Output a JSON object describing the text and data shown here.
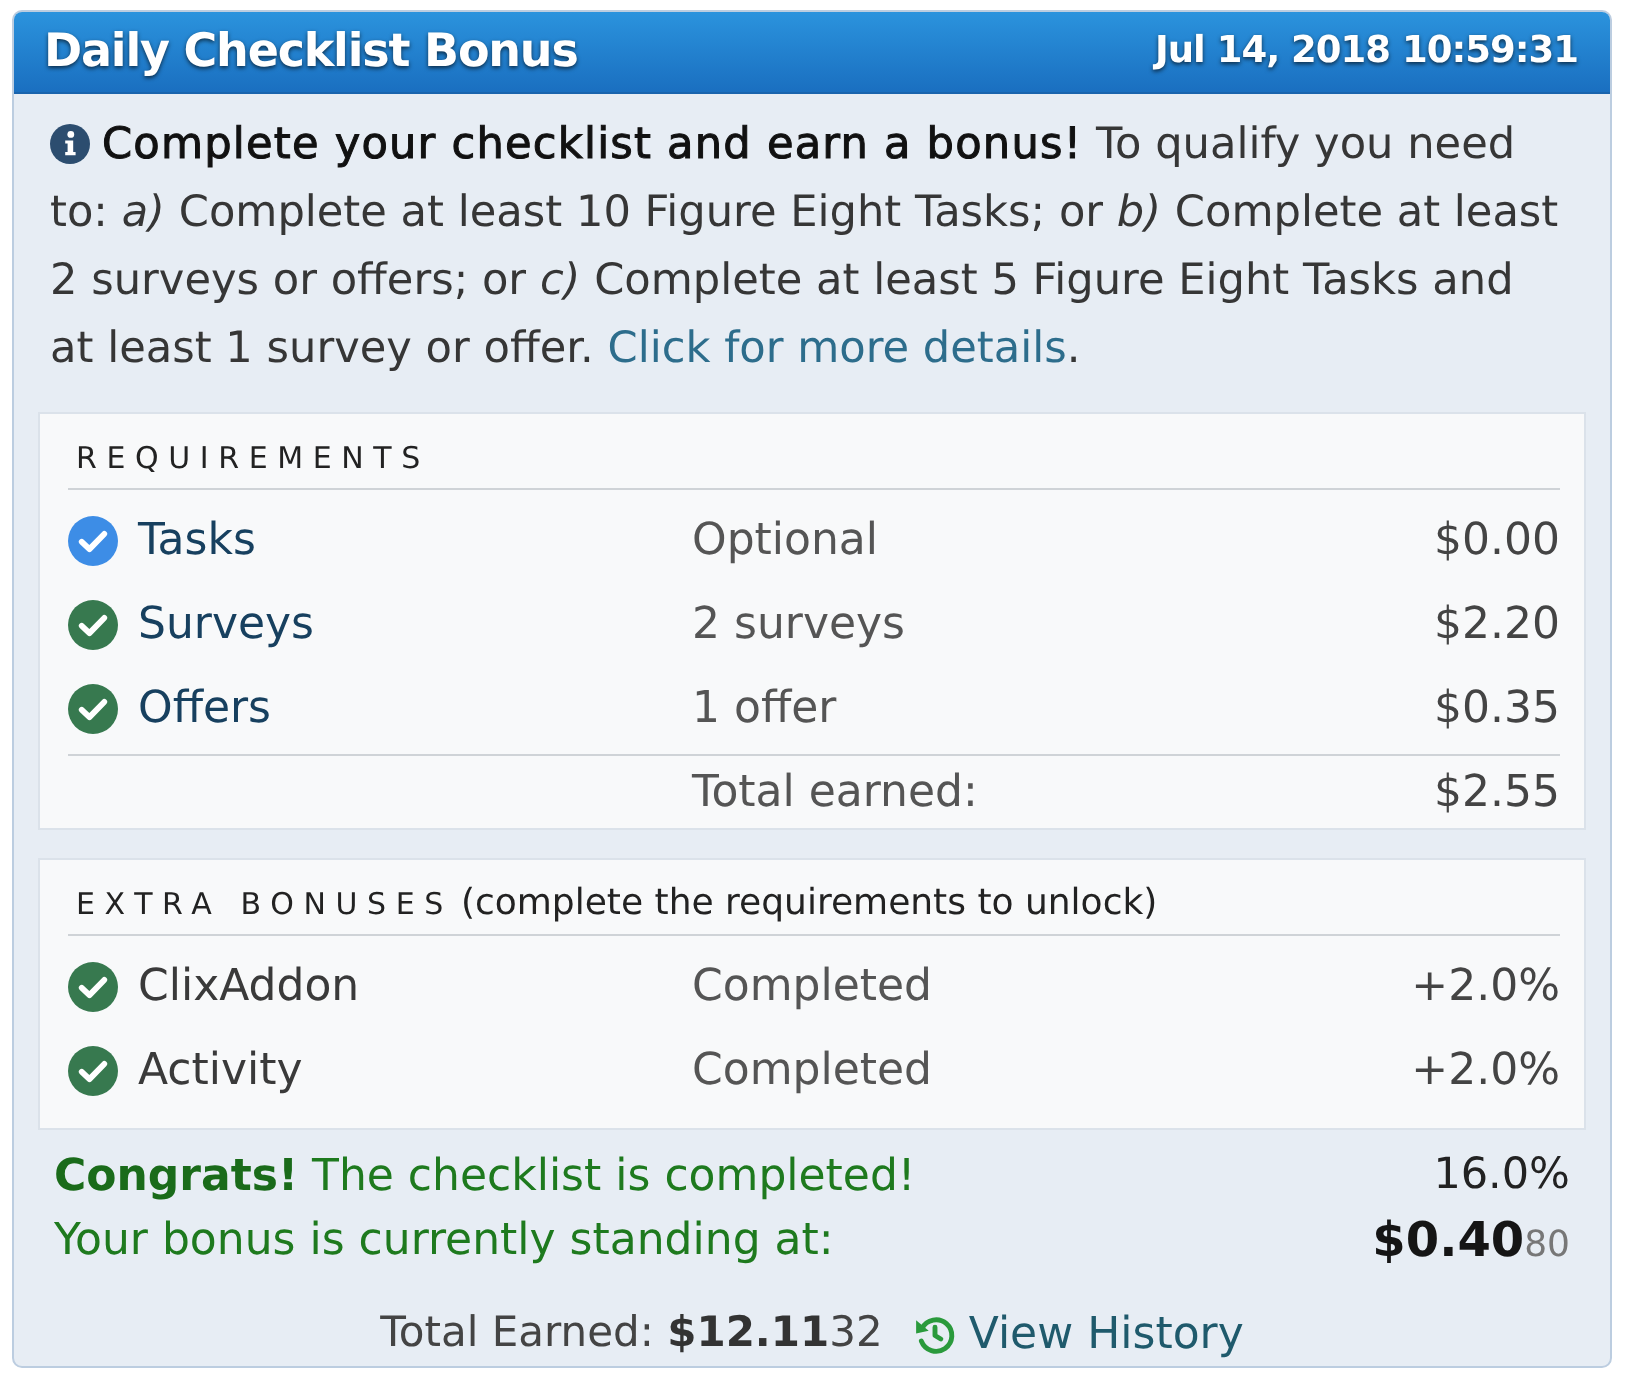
{
  "panel": {
    "title": "Daily Checklist Bonus",
    "timestamp": "Jul 14, 2018 10:59:31"
  },
  "intro": {
    "text": "**Complete your checklist and earn a bonus!** To qualify you need to: *a)* Complete at least 10 Figure Eight Tasks; or *b)* Complete at least 2 surveys or offers; or *c)* Complete at least 5 Figure Eight Tasks and at least 1 survey or offer.",
    "link": "Click for more details",
    "after_link": "."
  },
  "requirements": {
    "heading": "REQUIREMENTS",
    "items": [
      {
        "name": "Tasks",
        "status": "Optional",
        "amount": "$0.00",
        "color": "#3d8de6"
      },
      {
        "name": "Surveys",
        "status": "2 surveys",
        "amount": "$2.20",
        "color": "#37794f"
      },
      {
        "name": "Offers",
        "status": "1 offer",
        "amount": "$0.35",
        "color": "#37794f"
      }
    ],
    "total_label": "Total earned:",
    "total": "$2.55"
  },
  "extra_bonuses": {
    "heading": "EXTRA BONUSES",
    "note": "(complete the requirements to unlock)",
    "items": [
      {
        "name": "ClixAddon",
        "status": "Completed",
        "value": "+2.0%",
        "color": "#37794f"
      },
      {
        "name": "Activity",
        "status": "Completed",
        "value": "+2.0%",
        "color": "#37794f"
      }
    ]
  },
  "summary": {
    "message": "**Congrats!** The checklist is completed!",
    "percent": "16.0%",
    "standing_label": "Your bonus is currently standing at:",
    "standing_amount": "**$0.40**80",
    "total_earned": "Total Earned: **$12.11**32",
    "history_link": "View History"
  }
}
